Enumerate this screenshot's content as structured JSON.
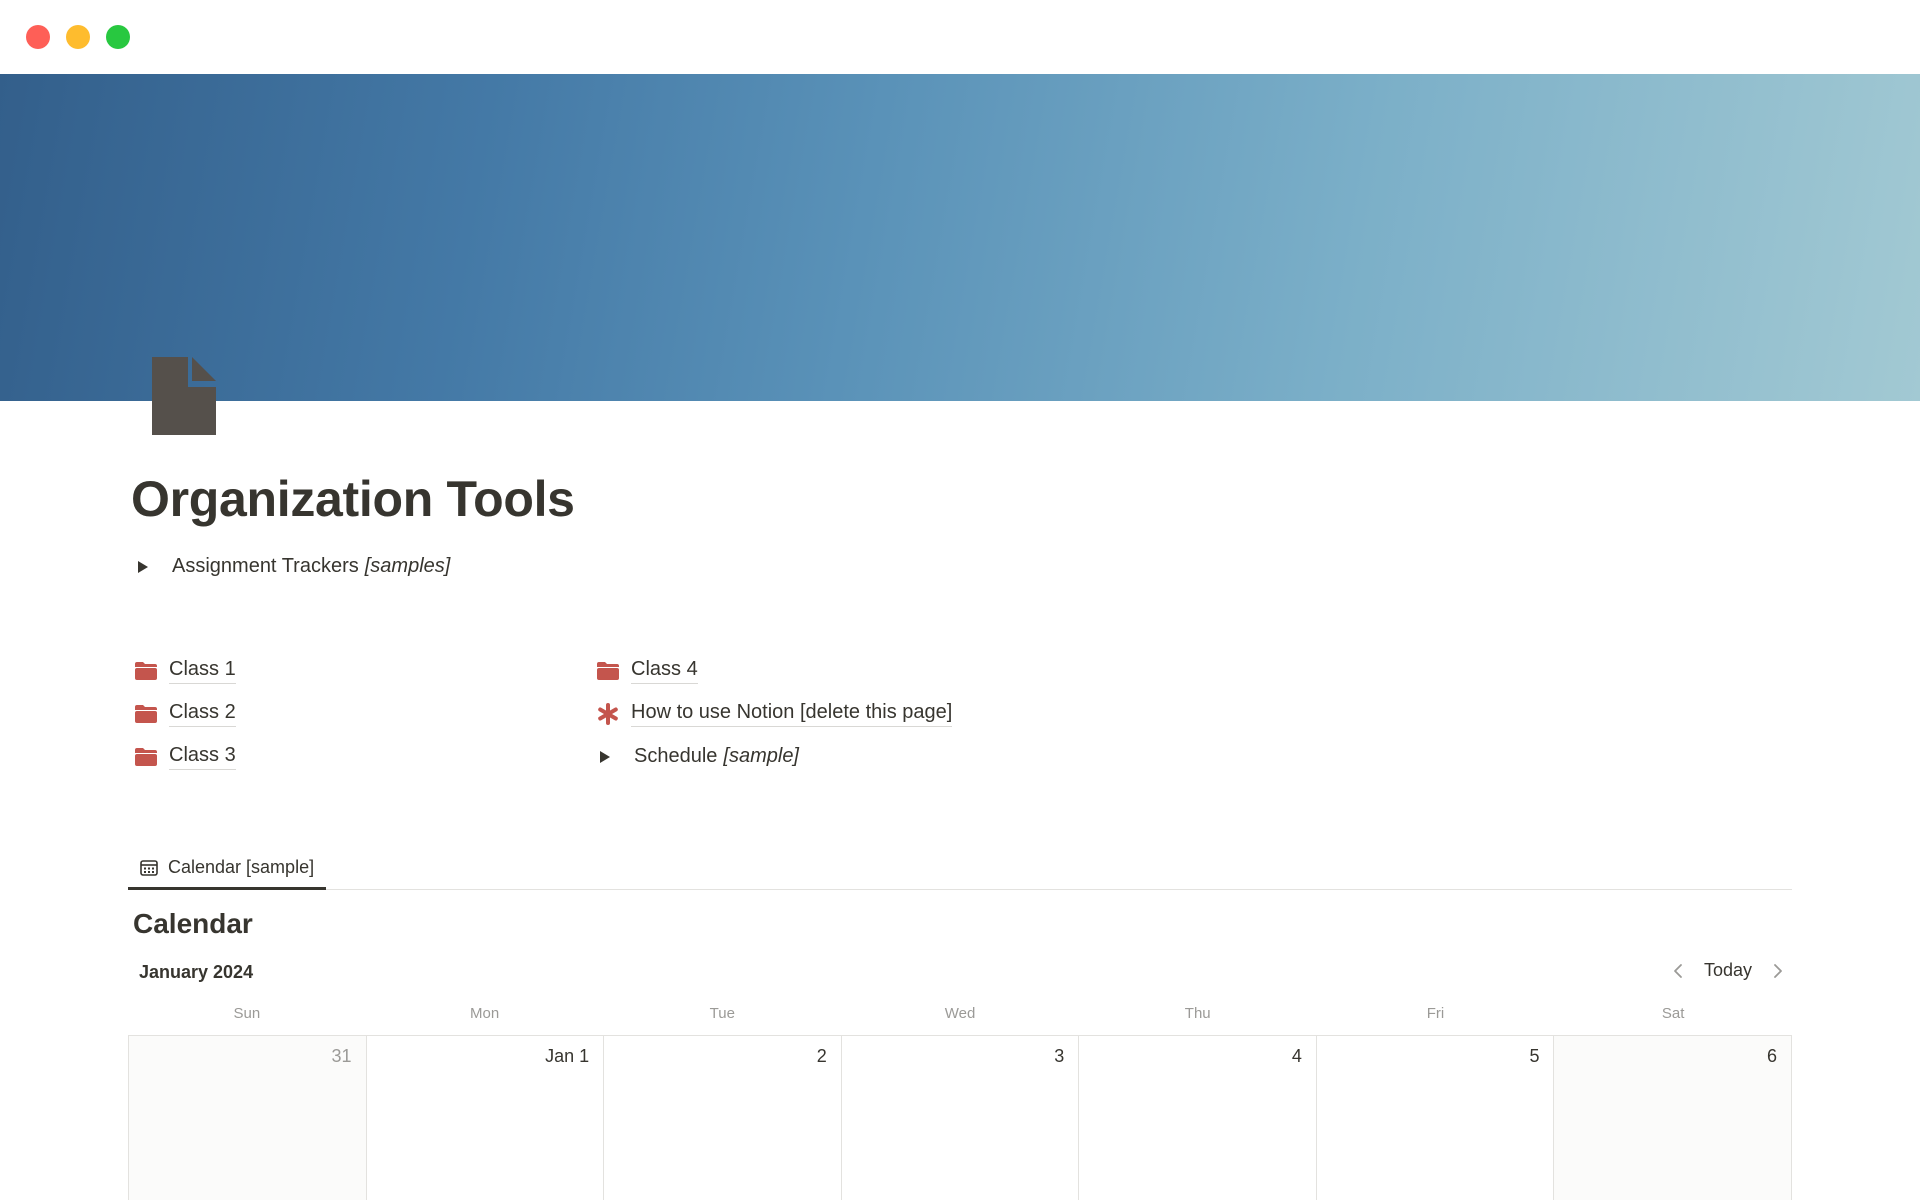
{
  "window": {
    "controls": [
      "close",
      "minimize",
      "zoom"
    ]
  },
  "page": {
    "title": "Organization Tools",
    "icon": "document-icon"
  },
  "toggles": {
    "assignment": {
      "label": "Assignment Trackers",
      "italic": "[samples]"
    },
    "schedule": {
      "label": "Schedule",
      "italic": "[sample]"
    }
  },
  "links": {
    "left": [
      {
        "label": "Class 1",
        "icon": "folder-icon"
      },
      {
        "label": "Class 2",
        "icon": "folder-icon"
      },
      {
        "label": "Class 3",
        "icon": "folder-icon"
      }
    ],
    "right": [
      {
        "label": "Class 4",
        "icon": "folder-icon"
      },
      {
        "label": "How to use Notion [delete this page]",
        "icon": "asterisk-icon"
      }
    ]
  },
  "colors": {
    "accent": "#c4554d",
    "text": "#37352f",
    "muted": "#9b9a97"
  },
  "database": {
    "tab_label": "Calendar [sample]",
    "title": "Calendar",
    "month": "January 2024",
    "today_label": "Today",
    "weekdays": [
      "Sun",
      "Mon",
      "Tue",
      "Wed",
      "Thu",
      "Fri",
      "Sat"
    ],
    "days": [
      "31",
      "Jan 1",
      "2",
      "3",
      "4",
      "5",
      "6"
    ]
  }
}
